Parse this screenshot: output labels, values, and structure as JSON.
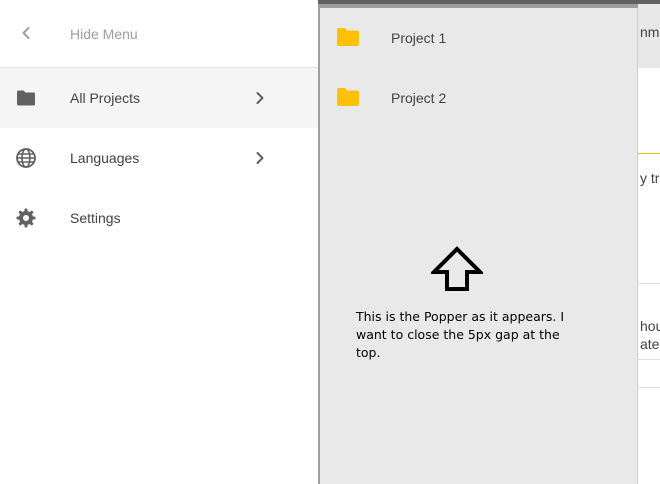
{
  "drawer": {
    "hide_menu_label": "Hide Menu",
    "items": [
      {
        "label": "All Projects",
        "icon": "folder-icon"
      },
      {
        "label": "Languages",
        "icon": "globe-icon"
      },
      {
        "label": "Settings",
        "icon": "gear-icon"
      }
    ]
  },
  "popper": {
    "items": [
      {
        "label": "Project 1",
        "icon": "folder-icon"
      },
      {
        "label": "Project 2",
        "icon": "folder-icon"
      }
    ]
  },
  "annotation": {
    "text": "This is the Popper as it appears. I want to close the 5px gap at the top."
  },
  "background": {
    "fragments": [
      "nme",
      "y tr",
      "hou",
      "ate"
    ]
  },
  "colors": {
    "folder_accent": "#FFC107",
    "drawer_icon": "#616161",
    "popper_bg": "#E9E9E9",
    "active_item_bg": "#F5F5F5"
  }
}
